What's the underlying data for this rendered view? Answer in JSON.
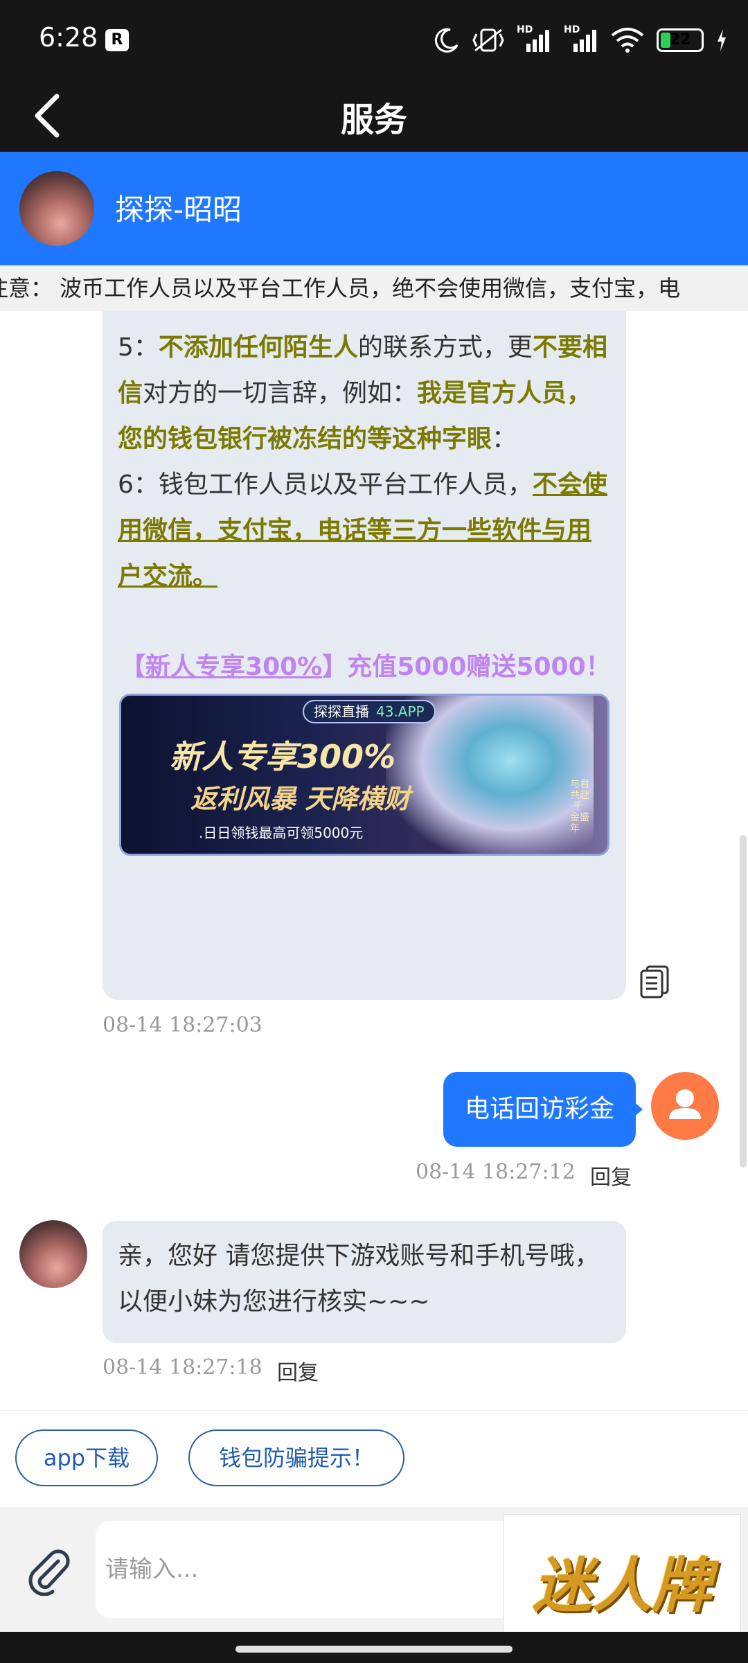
{
  "status_bar": {
    "time": "6:28",
    "app_badge": "R",
    "signal_label_1": "HD",
    "signal_label_2": "HD",
    "battery": "22",
    "battery_level": 0.22
  },
  "header": {
    "title": "服务",
    "back_icon": "chevron-left-icon"
  },
  "agent": {
    "name": "探探-昭昭"
  },
  "notice": {
    "text": "注意： 波币工作人员以及平台工作人员，绝不会使用微信，支付宝，电"
  },
  "messages": {
    "long": {
      "line5_prefix": "5：",
      "line5_bold1": "不添加任何陌生人",
      "line5_mid": "的联系方式，更",
      "line5_bold2": "不要相信",
      "line5_mid2": "对方的一切言辞，例如：",
      "line5_bold3": "我是官方人员，您的钱包银行被冻结的等这种字眼",
      "line5_end": "：",
      "line6_prefix": "6：钱包工作人员以及平台工作人员，",
      "line6_underline": "不会使用微信，支付宝，电话等三方一些软件与用户交流。",
      "promo_open": "【",
      "promo_link": "新人专享300%",
      "promo_close": "】充值5000赠送5000！",
      "banner": {
        "tag": "探探直播",
        "tag_domain": "43.APP",
        "headline": "新人专享300%",
        "subline": "返利风暴 天降横财",
        "footer": ".日日领钱最高可领5000元",
        "side": "与君共赴·千金盛年"
      },
      "timestamp": "08-14 18:27:03"
    },
    "mine": {
      "text": "电话回访彩金",
      "timestamp": "08-14 18:27:12",
      "reply": "回复"
    },
    "agent_reply": {
      "text": "亲，您好 请您提供下游戏账号和手机号哦，以便小妹为您进行核实~~~",
      "timestamp": "08-14 18:27:18",
      "reply": "回复"
    }
  },
  "quick_actions": [
    {
      "label": "app下载"
    },
    {
      "label": "钱包防骗提示！"
    }
  ],
  "composer": {
    "placeholder": "请输入...",
    "attach_icon": "paperclip-icon"
  },
  "sticker": {
    "text": "迷人牌"
  },
  "colors": {
    "brand_blue": "#1f78ff",
    "dark_bar": "#161616",
    "bubble_gray": "#e6eaf1",
    "olive": "#7a7a00",
    "promo_purple": "#c084f0",
    "user_avatar": "#ff7a45"
  }
}
